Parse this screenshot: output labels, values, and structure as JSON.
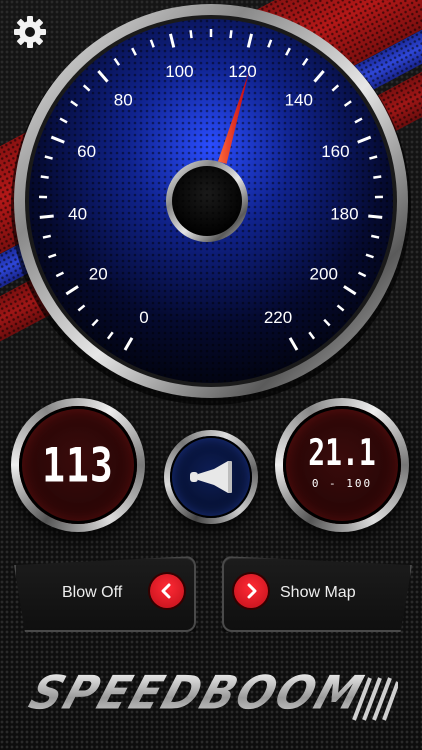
{
  "speedometer": {
    "labels": [
      "0",
      "20",
      "40",
      "60",
      "80",
      "100",
      "120",
      "140",
      "160",
      "180",
      "200",
      "220"
    ],
    "needle_value": 122,
    "min": 0,
    "max": 220
  },
  "left_gauge": {
    "value": "113"
  },
  "right_gauge": {
    "value": "21.1",
    "caption": "0 - 100"
  },
  "buttons": {
    "blow_off": "Blow Off",
    "show_map": "Show Map"
  },
  "logo": {
    "text": "SPEEDBOOM"
  },
  "colors": {
    "accent_red": "#d8101c",
    "gauge_blue": "#1e3cff",
    "stripe_red": "#b31818",
    "stripe_blue": "#2e46d6"
  },
  "icons": [
    "gear-icon",
    "horn-icon",
    "chevron-left-icon",
    "chevron-right-icon"
  ]
}
